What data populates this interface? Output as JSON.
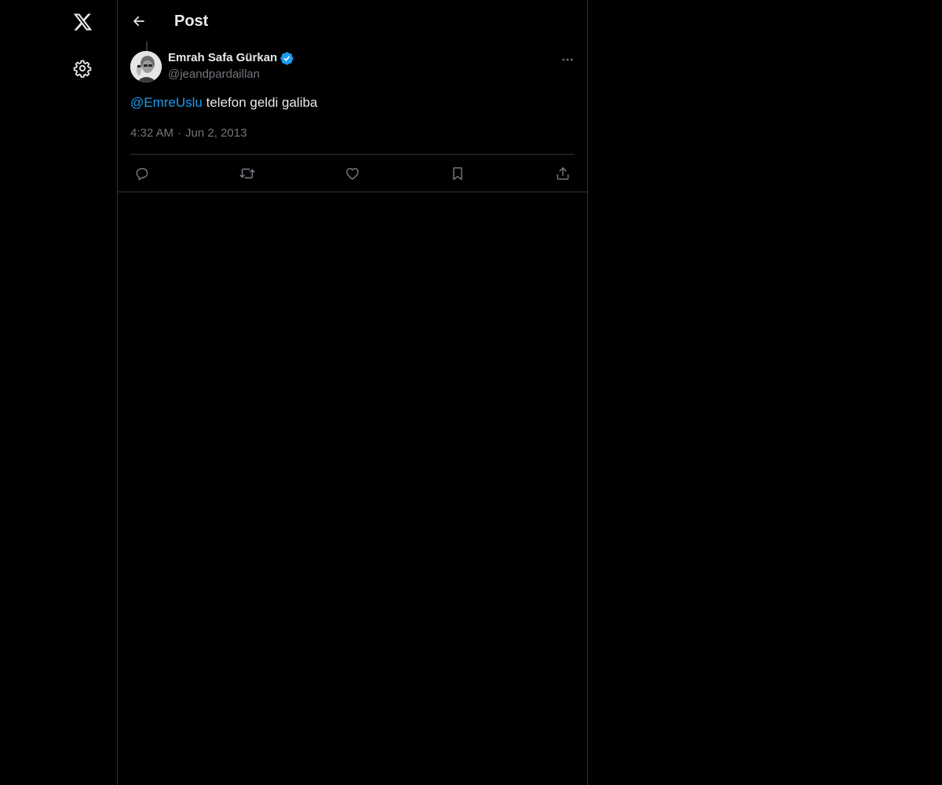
{
  "colors": {
    "background": "#000000",
    "text_primary": "#e7e9ea",
    "text_secondary": "#71767b",
    "accent": "#1d9bf0",
    "border": "#2f3336"
  },
  "nav": {
    "logo_icon": "x-logo-icon",
    "settings_icon": "gear-icon"
  },
  "header": {
    "back_icon": "arrow-left-icon",
    "title": "Post"
  },
  "post": {
    "author": {
      "name": "Emrah Safa Gürkan",
      "handle": "@jeandpardaillan",
      "verified": true,
      "verified_icon": "verified-badge-icon"
    },
    "text": {
      "mention": "@EmreUslu",
      "body": " telefon geldi galiba"
    },
    "time": "4:32 AM",
    "separator": "·",
    "date": "Jun 2, 2013",
    "more_icon": "more-horizontal-icon",
    "actions": [
      {
        "name": "reply",
        "icon": "reply-icon"
      },
      {
        "name": "repost",
        "icon": "repost-icon"
      },
      {
        "name": "like",
        "icon": "heart-icon"
      },
      {
        "name": "bookmark",
        "icon": "bookmark-icon"
      },
      {
        "name": "share",
        "icon": "share-icon"
      }
    ]
  }
}
